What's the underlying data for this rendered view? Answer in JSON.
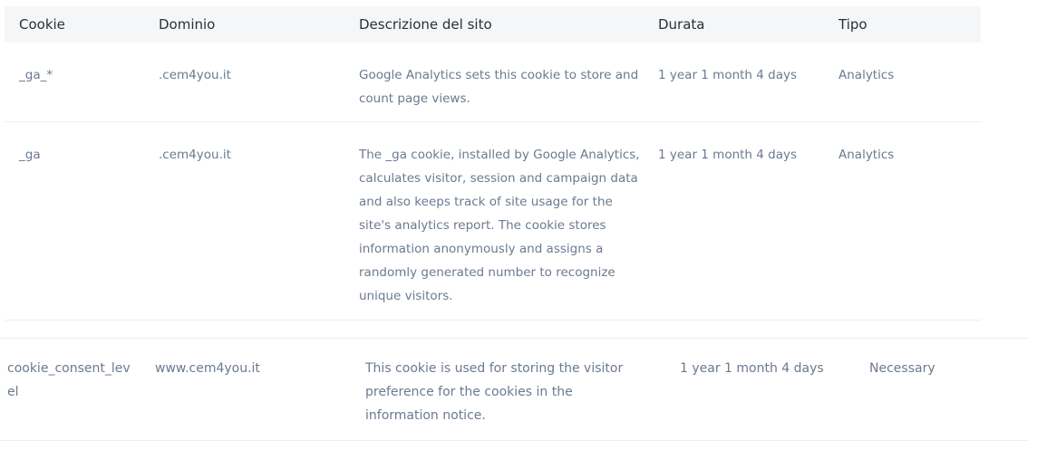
{
  "headers": {
    "cookie": "Cookie",
    "domain": "Dominio",
    "description": "Descrizione del sito",
    "duration": "Durata",
    "type": "Tipo"
  },
  "rows": [
    {
      "cookie": "_ga_*",
      "domain": ".cem4you.it",
      "description": "Google Analytics sets this cookie to store and count page views.",
      "duration": "1 year 1 month 4 days",
      "type": "Analytics"
    },
    {
      "cookie": "_ga",
      "domain": ".cem4you.it",
      "description": "The _ga cookie, installed by Google Analytics, calculates visitor, session and campaign data and also keeps track of site usage for the site's analytics report. The cookie stores information anonymously and assigns a randomly generated number to recognize unique visitors.",
      "duration": "1 year 1 month 4 days",
      "type": "Analytics"
    }
  ],
  "necessary_row": {
    "cookie": "cookie_consent_level",
    "domain": "www.cem4you.it",
    "description": "This cookie is used for storing the visitor preference for the cookies in the information notice.",
    "duration": "1 year 1 month 4 days",
    "type": "Necessary"
  }
}
